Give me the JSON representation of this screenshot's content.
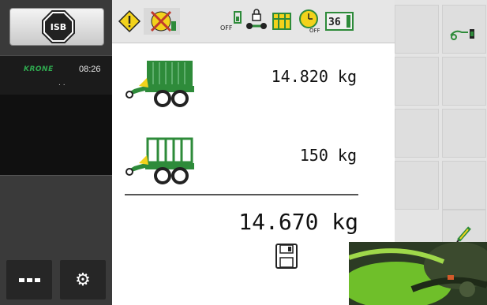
{
  "isb": {
    "label": "ISB"
  },
  "status": {
    "brand": "KRONE",
    "time": "08:26",
    "dots": ". ."
  },
  "weights": {
    "gross": "14.820 kg",
    "tare": "150 kg",
    "net": "14.670 kg"
  },
  "toolbar": {
    "off_label": "OFF",
    "timer_off_label": "OFF",
    "counter_label": "36"
  },
  "colors": {
    "krone_green": "#2fa84f",
    "wagon_green": "#2e8b3a",
    "warning_yellow": "#f2d21b",
    "panel_dark": "#3a3a3a"
  },
  "icons": [
    "isb-icon",
    "warning-icon",
    "forbidden-icon",
    "off-fill-icon",
    "lock-axle-icon",
    "table-icon",
    "timer-off-icon",
    "counter-icon",
    "menu-icon",
    "gear-icon",
    "wagon-full-icon",
    "wagon-empty-icon",
    "save-icon",
    "hitch-icon",
    "pen-icon"
  ]
}
